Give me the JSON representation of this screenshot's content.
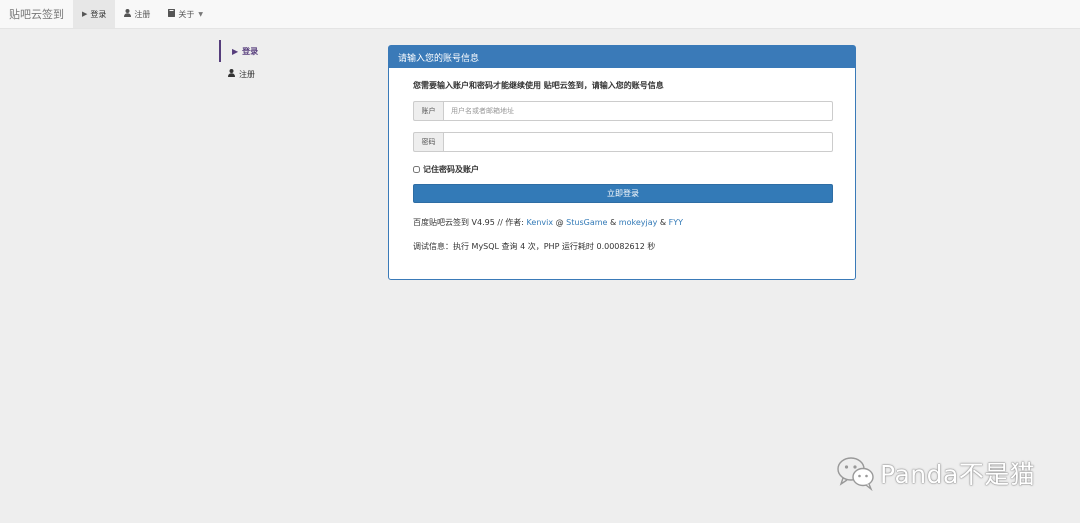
{
  "navbar": {
    "brand": "贴吧云签到",
    "items": [
      {
        "icon": "play-icon",
        "label": "登录",
        "active": true
      },
      {
        "icon": "user-icon",
        "label": "注册",
        "active": false
      },
      {
        "icon": "book-icon",
        "label": "关于",
        "active": false,
        "dropdown": true
      }
    ]
  },
  "sidebar": {
    "items": [
      {
        "icon": "play-icon",
        "label": "登录",
        "active": true
      },
      {
        "icon": "user-icon",
        "label": "注册",
        "active": false
      }
    ]
  },
  "panel": {
    "heading": "请输入您的账号信息",
    "intro": "您需要输入账户和密码才能继续使用 贴吧云签到，请输入您的账号信息",
    "account": {
      "label": "账户",
      "placeholder": "用户名或者邮箱地址",
      "value": ""
    },
    "password": {
      "label": "密码",
      "value": ""
    },
    "remember_label": "记住密码及账户",
    "submit_label": "立即登录",
    "footer": {
      "prefix": "百度贴吧云签到 V4.95 // 作者: ",
      "author1": "Kenvix",
      "at": " @ ",
      "author2": "StusGame",
      "amp1": " & ",
      "author3": "mokeyjay",
      "amp2": " & ",
      "author4": "FYY"
    },
    "debug": "调试信息：执行 MySQL 查询 4 次，PHP 运行耗时 0.00082612 秒"
  },
  "watermark": {
    "text": "Panda不是猫",
    "icon": "wechat-icon"
  },
  "colors": {
    "primary": "#337ab7",
    "sidebar_accent": "#563d7c",
    "background": "#eeeeee"
  }
}
